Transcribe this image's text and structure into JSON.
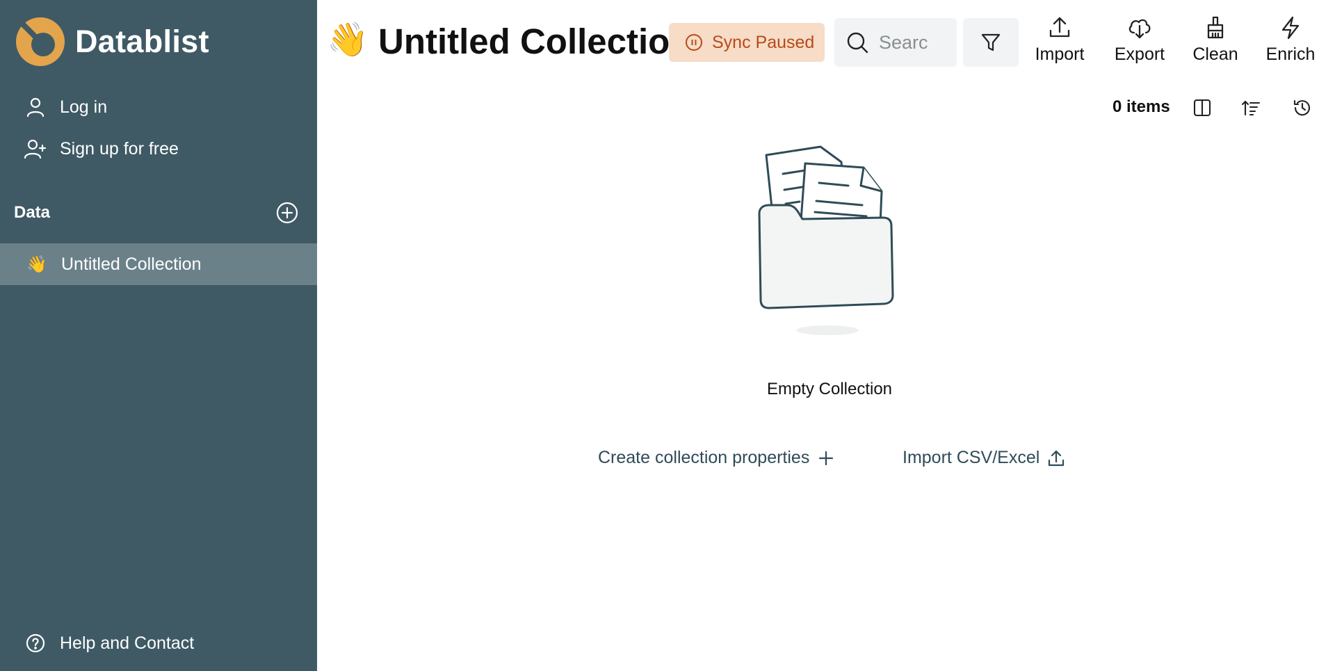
{
  "brand": {
    "name": "Datablist"
  },
  "sidebar": {
    "login_label": "Log in",
    "signup_label": "Sign up for free",
    "data_section_title": "Data",
    "collections": [
      {
        "emoji": "👋",
        "label": "Untitled Collection"
      }
    ],
    "help_label": "Help and Contact"
  },
  "header": {
    "emoji": "👋",
    "title": "Untitled Collection",
    "sync_status": "Sync Paused",
    "search_placeholder": "Searc",
    "tools": {
      "import": "Import",
      "export": "Export",
      "clean": "Clean",
      "enrich": "Enrich"
    }
  },
  "toolbar": {
    "items_count": "0 items"
  },
  "empty_state": {
    "message": "Empty Collection",
    "create_properties": "Create collection properties",
    "import_csv": "Import CSV/Excel"
  },
  "colors": {
    "sidebar_bg": "#3f5a65",
    "sidebar_active": "#6b818a",
    "brand_accent": "#e3a44c",
    "sync_badge_bg": "#f7dcc7",
    "sync_badge_text": "#b64b1a",
    "link": "#2f4b57"
  }
}
